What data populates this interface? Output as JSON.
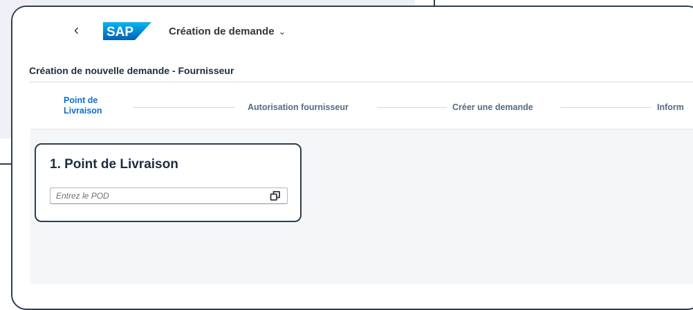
{
  "shell": {
    "back_label": "‹",
    "logo_text": "SAP",
    "app_title": "Création de demande",
    "app_title_chevron": "⌄",
    "brand_color": "#0a6ed1"
  },
  "page": {
    "title": "Création de nouvelle demande - Fournisseur"
  },
  "wizard": {
    "steps": [
      {
        "label": "Point de Livraison",
        "active": true
      },
      {
        "label": "Autorisation fournisseur",
        "active": false
      },
      {
        "label": "Créer une demande",
        "active": false
      },
      {
        "label": "Inform",
        "active": false
      }
    ]
  },
  "step_card": {
    "title": "1. Point de Livraison",
    "pod_placeholder": "Entrez le POD",
    "pod_value": "",
    "value_help_icon": "value-help-icon"
  }
}
